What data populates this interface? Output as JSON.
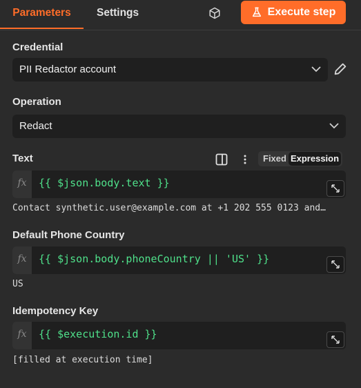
{
  "tabs": {
    "parameters": "Parameters",
    "settings": "Settings"
  },
  "header": {
    "execute_label": "Execute step",
    "accent": "#ff6d29"
  },
  "credential": {
    "label": "Credential",
    "value": "PII Redactor account"
  },
  "operation": {
    "label": "Operation",
    "value": "Redact"
  },
  "text": {
    "label": "Text",
    "mode_fixed": "Fixed",
    "mode_expression": "Expression",
    "expression": "{{ $json.body.text }}",
    "result": "Contact synthetic.user@example.com at +1 202 555 0123 and…"
  },
  "phone_country": {
    "label": "Default Phone Country",
    "expression": "{{ $json.body.phoneCountry || 'US' }}",
    "result": "US"
  },
  "idempotency": {
    "label": "Idempotency Key",
    "expression": "{{ $execution.id }}",
    "result": "[filled at execution time]"
  },
  "fx_label": "fx",
  "icons": [
    "cube-icon",
    "flask-icon",
    "chevron-down-icon",
    "pencil-icon",
    "panel-icon",
    "more-vertical-icon",
    "expand-icon"
  ]
}
